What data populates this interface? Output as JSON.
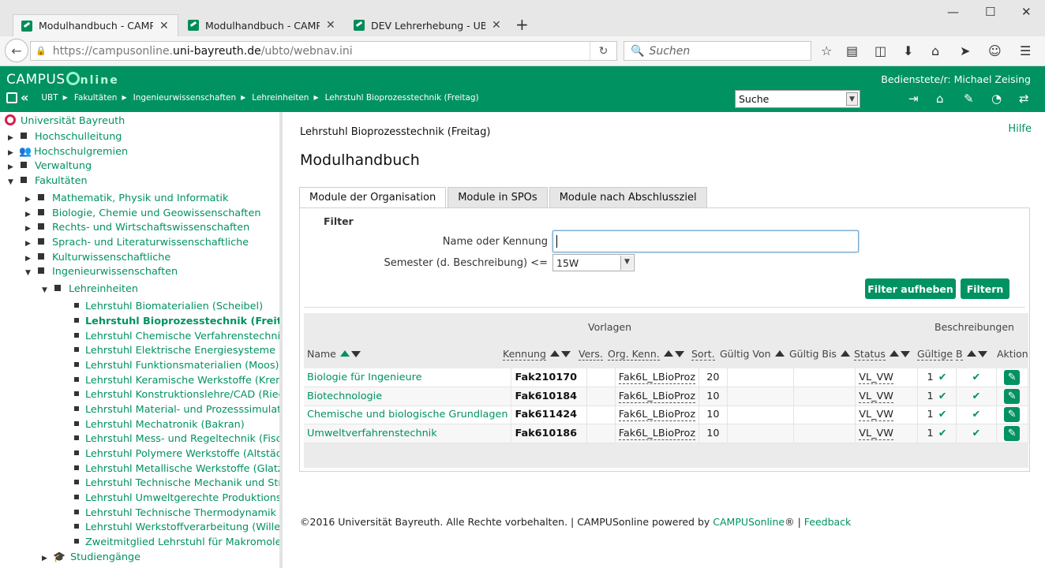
{
  "browser": {
    "tabs": [
      {
        "title": "Modulhandbuch - CAMP...",
        "active": true
      },
      {
        "title": "Modulhandbuch - CAMP...",
        "active": false
      },
      {
        "title": "DEV Lehrerhebung - UBT -...",
        "active": false
      }
    ],
    "url_prefix": "https://campusonline.",
    "url_domain": "uni-bayreuth.de",
    "url_path": "/ubto/webnav.ini",
    "search_placeholder": "Suchen"
  },
  "header": {
    "logo_campus": "CAMPUS",
    "logo_online": "nline",
    "user_label": "Bedienstete/r:",
    "user_name": "Michael Zeising",
    "breadcrumbs": [
      "UBT",
      "Fakultäten",
      "Ingenieurwissenschaften",
      "Lehreinheiten",
      "Lehrstuhl Bioprozesstechnik (Freitag)"
    ],
    "search_select": "Suche"
  },
  "sidebar": {
    "root": "Universität Bayreuth",
    "items": [
      {
        "label": "Hochschulleitung"
      },
      {
        "label": "Hochschulgremien"
      },
      {
        "label": "Verwaltung"
      },
      {
        "label": "Fakultäten"
      },
      {
        "label": "Mathematik, Physik und Informatik"
      },
      {
        "label": "Biologie, Chemie und Geowissenschaften"
      },
      {
        "label": "Rechts- und Wirtschaftswissenschaften"
      },
      {
        "label": "Sprach- und Literaturwissenschaftliche"
      },
      {
        "label": "Kulturwissenschaftliche"
      },
      {
        "label": "Ingenieurwissenschaften"
      },
      {
        "label": "Lehreinheiten"
      },
      {
        "label": "Lehrstuhl Biomaterialien (Scheibel)"
      },
      {
        "label": "Lehrstuhl Bioprozesstechnik (Freitag)"
      },
      {
        "label": "Lehrstuhl Chemische Verfahrenstechnik (Jes"
      },
      {
        "label": "Lehrstuhl Elektrische Energiesysteme (Danz"
      },
      {
        "label": "Lehrstuhl Funktionsmaterialien (Moos)"
      },
      {
        "label": "Lehrstuhl Keramische Werkstoffe (Krenkel)"
      },
      {
        "label": "Lehrstuhl Konstruktionslehre/CAD (Rieg)"
      },
      {
        "label": "Lehrstuhl Material- und Prozesssimulation"
      },
      {
        "label": "Lehrstuhl Mechatronik (Bakran)"
      },
      {
        "label": "Lehrstuhl Mess- und Regeltechnik (Fischera"
      },
      {
        "label": "Lehrstuhl Polymere Werkstoffe (Altstädt)"
      },
      {
        "label": "Lehrstuhl Metallische Werkstoffe (Glatzel)"
      },
      {
        "label": "Lehrstuhl Technische Mechanik und Strömu"
      },
      {
        "label": "Lehrstuhl Umweltgerechte Produktionstech"
      },
      {
        "label": "Lehrstuhl Technische Thermodynamik und T"
      },
      {
        "label": "Lehrstuhl Werkstoffverarbeitung (Willert-Po"
      },
      {
        "label": "Zweitmitglied Lehrstuhl für Makromolekula"
      },
      {
        "label": "Studiengänge"
      }
    ]
  },
  "main": {
    "org": "Lehrstuhl Bioprozesstechnik (Freitag)",
    "help": "Hilfe",
    "title": "Modulhandbuch",
    "tabs": [
      "Module der Organisation",
      "Module in SPOs",
      "Module nach Abschlussziel"
    ],
    "filter": {
      "heading": "Filter",
      "name_label": "Name oder Kennung",
      "name_value": "",
      "semester_label": "Semester (d. Beschreibung) <=",
      "semester_value": "15W",
      "reset_btn": "Filter aufheben",
      "apply_btn": "Filtern"
    },
    "table": {
      "group_vorlagen": "Vorlagen",
      "group_beschreibungen": "Beschreibungen",
      "columns": [
        "Name",
        "Kennung",
        "Vers.",
        "Org. Kenn.",
        "Sort.",
        "Gültig Von",
        "Gültig Bis",
        "Status",
        "Gültige",
        "B",
        "Aktion"
      ],
      "rows": [
        {
          "name": "Biologie für Ingenieure",
          "kennung": "Fak210170",
          "vers": "",
          "org": "Fak6L_LBioProz",
          "sort": "20",
          "von": "",
          "bis": "",
          "status": "VL_VW",
          "gueltige": "1"
        },
        {
          "name": "Biotechnologie",
          "kennung": "Fak610184",
          "vers": "",
          "org": "Fak6L_LBioProz",
          "sort": "10",
          "von": "",
          "bis": "",
          "status": "VL_VW",
          "gueltige": "1"
        },
        {
          "name": "Chemische und biologische Grundlagen",
          "kennung": "Fak611424",
          "vers": "",
          "org": "Fak6L_LBioProz",
          "sort": "10",
          "von": "",
          "bis": "",
          "status": "VL_VW",
          "gueltige": "1"
        },
        {
          "name": "Umweltverfahrenstechnik",
          "kennung": "Fak610186",
          "vers": "",
          "org": "Fak6L_LBioProz",
          "sort": "10",
          "von": "",
          "bis": "",
          "status": "VL_VW",
          "gueltige": "1"
        }
      ]
    }
  },
  "footer": {
    "copyright": "©2016 Universität Bayreuth. Alle Rechte vorbehalten. | CAMPUSonline powered by",
    "link1": "CAMPUSonline",
    "reg": "® |",
    "link2": "Feedback"
  }
}
